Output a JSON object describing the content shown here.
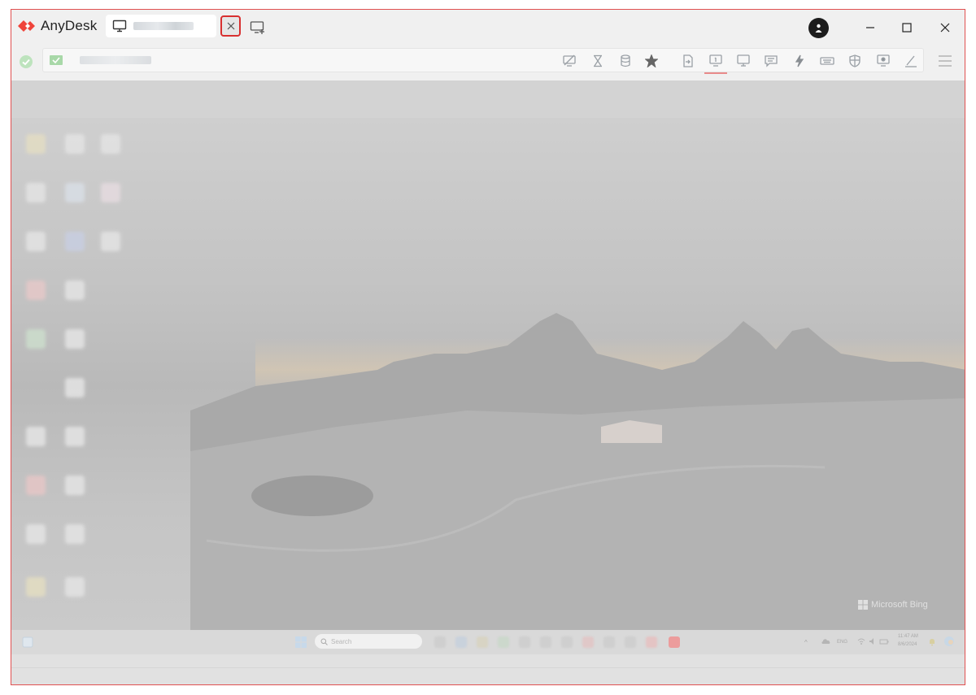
{
  "app": {
    "name": "AnyDesk",
    "brand_color": "#ef443b"
  },
  "tab": {
    "label": "",
    "highlight_color": "#d83030"
  },
  "address": {
    "value": ""
  },
  "toolbar": {
    "icons": [
      "privacy-icon",
      "timer-icon",
      "storage-icon",
      "favorite-star-icon",
      "file-transfer-icon",
      "monitor-one-icon",
      "display-icon",
      "chat-icon",
      "actions-icon",
      "keyboard-icon",
      "permissions-shield-icon",
      "screenshot-icon",
      "whiteboard-pen-icon"
    ]
  },
  "remote": {
    "watermark": "Microsoft Bing",
    "search_placeholder": "Search",
    "tray_lang": "ENG",
    "clock_time": "11:47 AM",
    "clock_date": "8/6/2024"
  }
}
